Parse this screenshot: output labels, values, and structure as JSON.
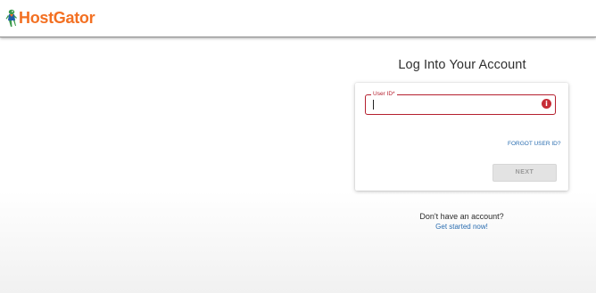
{
  "brand": {
    "name": "HostGator",
    "color": "#f37022"
  },
  "login": {
    "title": "Log Into Your Account",
    "user_id_label": "User ID*",
    "user_id_value": "",
    "error_icon": "i",
    "forgot_label": "FORGOT USER ID?",
    "next_label": "NEXT"
  },
  "signup": {
    "prompt": "Don't have an account?",
    "link": "Get started now!"
  },
  "colors": {
    "error": "#b5202f",
    "link": "#2a6db0",
    "button_disabled": "#e3e3e3"
  }
}
